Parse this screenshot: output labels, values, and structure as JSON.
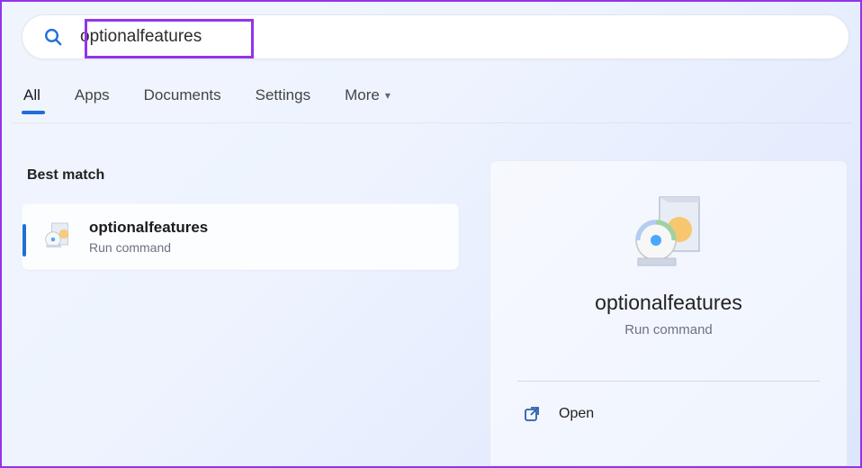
{
  "search": {
    "value": "optionalfeatures",
    "placeholder": ""
  },
  "tabs": {
    "all": "All",
    "apps": "Apps",
    "documents": "Documents",
    "settings": "Settings",
    "more": "More"
  },
  "results": {
    "section_title": "Best match",
    "top": {
      "title": "optionalfeatures",
      "subtitle": "Run command"
    }
  },
  "detail": {
    "title": "optionalfeatures",
    "subtitle": "Run command",
    "actions": {
      "open": "Open"
    }
  }
}
